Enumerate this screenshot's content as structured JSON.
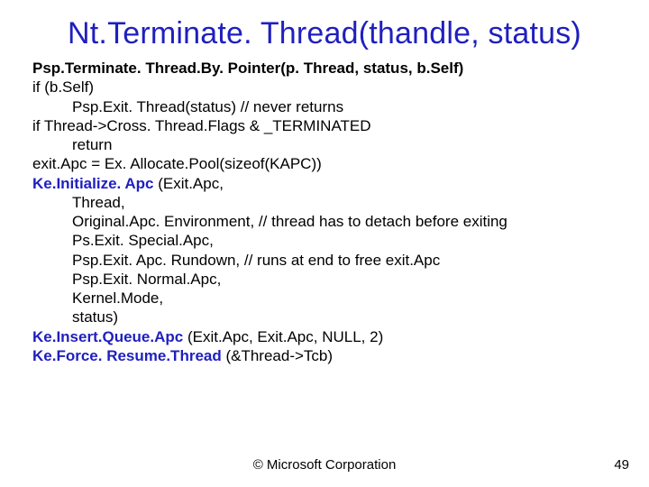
{
  "title": "Nt.Terminate. Thread(thandle, status)",
  "lines": [
    {
      "cls": "b",
      "text": "Psp.Terminate. Thread.By. Pointer(p. Thread, status, b.Self)"
    },
    {
      "cls": "",
      "text": "if (b.Self)"
    },
    {
      "cls": "indent1",
      "text": "Psp.Exit. Thread(status)  // never returns"
    },
    {
      "cls": "",
      "text": "if Thread->Cross. Thread.Flags & _TERMINATED"
    },
    {
      "cls": "indent1",
      "text": "return"
    },
    {
      "cls": "",
      "text": "exit.Apc = Ex. Allocate.Pool(sizeof(KAPC))"
    },
    {
      "cls": "blue",
      "text": "Ke.Initialize. Apc "
    },
    {
      "cls": "",
      "text_after": "(Exit.Apc,",
      "inline_after": true
    },
    {
      "cls": "indent1",
      "text": "Thread,"
    },
    {
      "cls": "indent1",
      "text": "Original.Apc. Environment,      // thread has to detach before exiting"
    },
    {
      "cls": "indent1",
      "text": "Ps.Exit. Special.Apc,"
    },
    {
      "cls": "indent1",
      "text": "Psp.Exit. Apc. Rundown,            // runs at end to free exit.Apc"
    },
    {
      "cls": "indent1",
      "text": "Psp.Exit. Normal.Apc,"
    },
    {
      "cls": "indent1",
      "text": "Kernel.Mode,"
    },
    {
      "cls": "indent1",
      "text": "status)"
    },
    {
      "cls": "blue",
      "text": "Ke.Insert.Queue.Apc "
    },
    {
      "cls": "",
      "text_after": "(Exit.Apc, Exit.Apc, NULL, 2)",
      "inline_after": true
    },
    {
      "cls": "blue",
      "text": "Ke.Force. Resume.Thread "
    },
    {
      "cls": "",
      "text_after": "(&Thread->Tcb)",
      "inline_after": true
    }
  ],
  "footer": "© Microsoft Corporation",
  "page": "49"
}
